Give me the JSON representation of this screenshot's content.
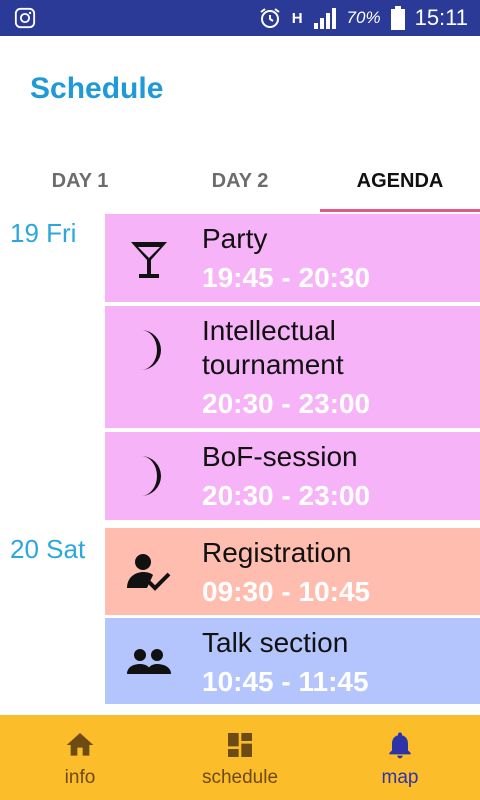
{
  "status_bar": {
    "time": "15:11",
    "battery": "70%",
    "network": "H"
  },
  "app": {
    "title": "Schedule"
  },
  "tabs": [
    {
      "label": "DAY 1",
      "active": false
    },
    {
      "label": "DAY 2",
      "active": false
    },
    {
      "label": "AGENDA",
      "active": true
    }
  ],
  "days": [
    {
      "label": "19 Fri"
    },
    {
      "label": "20 Sat"
    }
  ],
  "events": [
    {
      "title": "Party",
      "time": "19:45 - 20:30",
      "icon": "cocktail-icon",
      "color": "#f6b3f7"
    },
    {
      "title": "Intellectual tournament",
      "title_line1": "Intellectual",
      "title_line2": "tournament",
      "time": "20:30 - 23:00",
      "icon": "moon-icon",
      "color": "#f6b3f7"
    },
    {
      "title": "BoF-session",
      "time": "20:30 - 23:00",
      "icon": "moon-icon",
      "color": "#f6b3f7"
    },
    {
      "title": "Registration",
      "time": "09:30 - 10:45",
      "icon": "person-check-icon",
      "color": "#ffbdb0"
    },
    {
      "title": "Talk section",
      "time": "10:45 - 11:45",
      "icon": "people-icon",
      "color": "#b3c5fc"
    }
  ],
  "bottom_nav": [
    {
      "label": "info",
      "icon": "home-icon",
      "active": false
    },
    {
      "label": "schedule",
      "icon": "dashboard-icon",
      "active": false
    },
    {
      "label": "map",
      "icon": "bell-icon",
      "active": true
    }
  ],
  "colors": {
    "status_bar": "#2a3a96",
    "accent": "#1f9ad6",
    "tab_indicator": "#e35a8a",
    "bottom_nav": "#fbbd2a"
  }
}
